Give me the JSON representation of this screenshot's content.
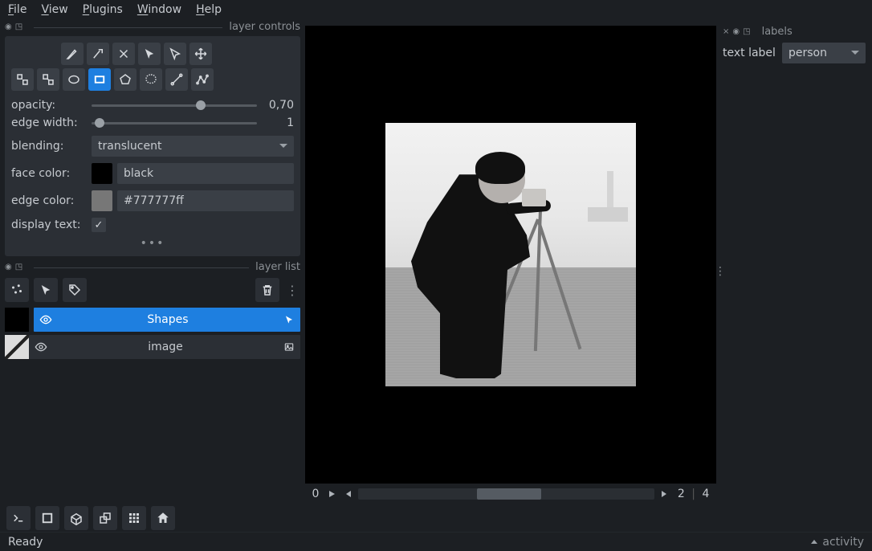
{
  "menu": {
    "file": "File",
    "view": "View",
    "plugins": "Plugins",
    "window": "Window",
    "help": "Help"
  },
  "left": {
    "panel_layer_controls": "layer controls",
    "opacity": {
      "label": "opacity:",
      "value": "0,70",
      "pos": 0.63
    },
    "edge_width": {
      "label": "edge width:",
      "value": "1",
      "pos": 0.02
    },
    "blending": {
      "label": "blending:",
      "value": "translucent"
    },
    "face_color": {
      "label": "face color:",
      "swatch": "#000000",
      "value": "black"
    },
    "edge_color": {
      "label": "edge color:",
      "swatch": "#777777",
      "value": "#777777ff"
    },
    "display_text": {
      "label": "display text:",
      "checked": true
    },
    "panel_layer_list": "layer list",
    "layers": [
      {
        "name": "Shapes",
        "selected": true
      },
      {
        "name": "image",
        "selected": false
      }
    ]
  },
  "right": {
    "panel_title": "labels",
    "text_label": "text label",
    "value": "person"
  },
  "timeline": {
    "start": "0",
    "end": "2",
    "max": "4"
  },
  "status": {
    "ready": "Ready",
    "activity": "activity"
  }
}
